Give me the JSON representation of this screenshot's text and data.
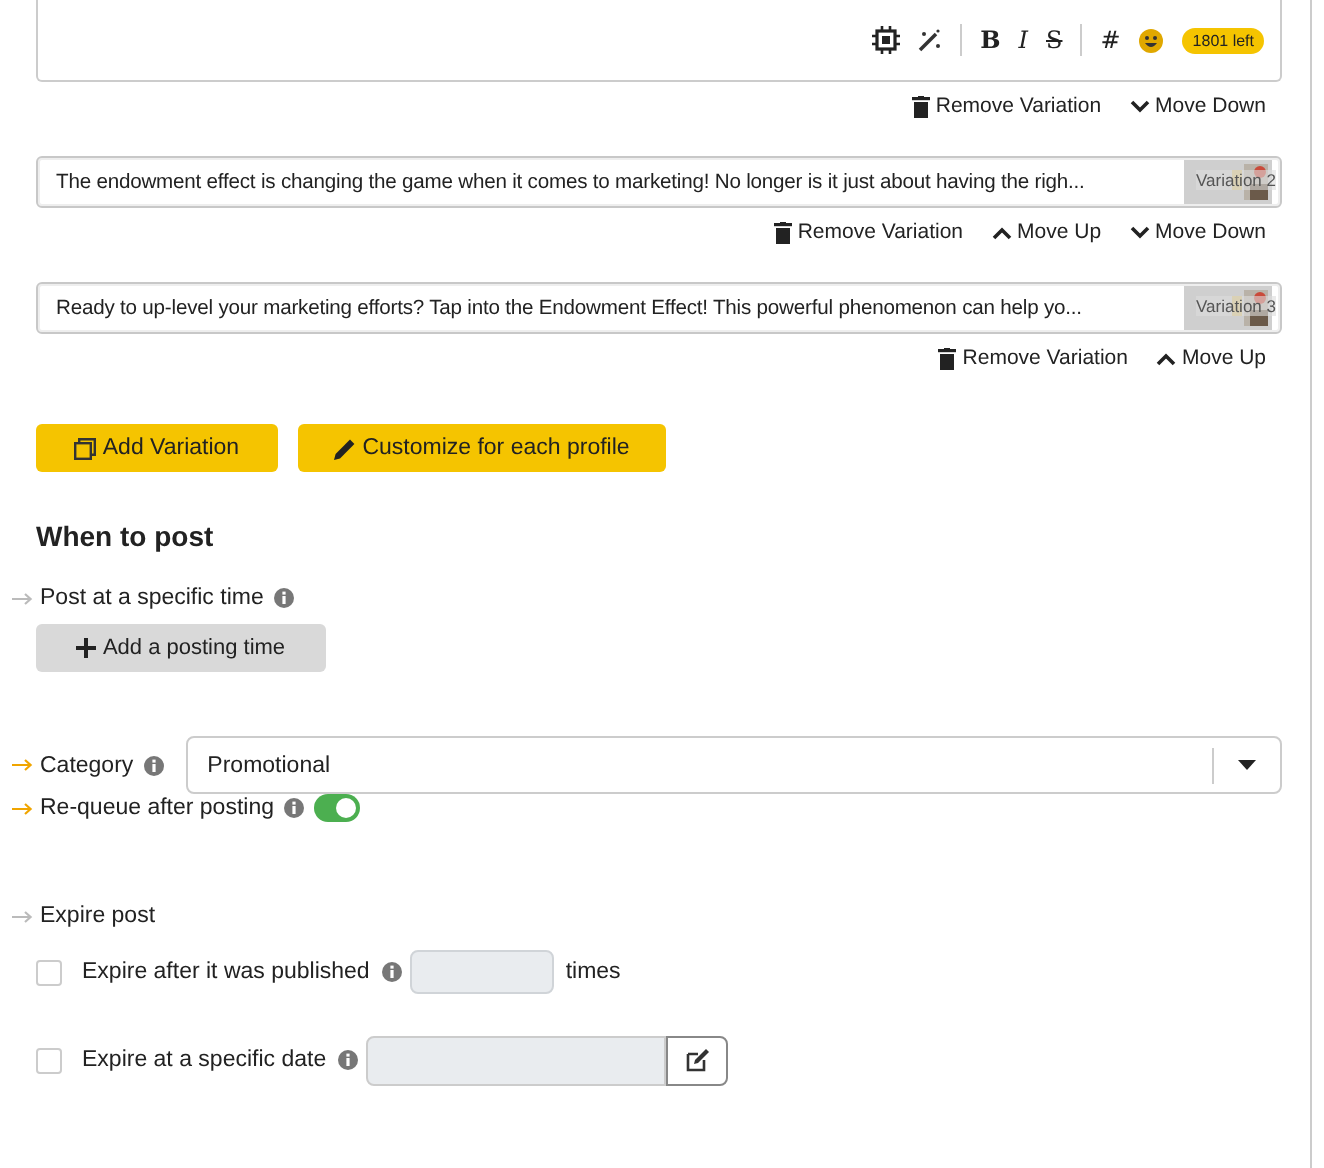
{
  "editor": {
    "toolbar": {
      "bold": "B",
      "italic": "I",
      "strike": "S",
      "hashtag": "#",
      "counter": "1801 left"
    },
    "actions": [
      {
        "kind": "remove",
        "label": "Remove Variation"
      },
      {
        "kind": "down",
        "label": "Move Down"
      }
    ]
  },
  "variations": [
    {
      "text": "The endowment effect is changing the game when it comes to marketing! No longer is it just about having the righ...",
      "tag": "Variation 2",
      "actions": [
        {
          "kind": "remove",
          "label": "Remove Variation"
        },
        {
          "kind": "up",
          "label": "Move Up"
        },
        {
          "kind": "down",
          "label": "Move Down"
        }
      ]
    },
    {
      "text": "Ready to up-level your marketing efforts? Tap into the Endowment Effect! This powerful phenomenon can help yo...",
      "tag": "Variation 3",
      "actions": [
        {
          "kind": "remove",
          "label": "Remove Variation"
        },
        {
          "kind": "up",
          "label": "Move Up"
        }
      ]
    }
  ],
  "buttons": [
    {
      "kind": "copy",
      "label": "Add Variation"
    },
    {
      "kind": "pencil",
      "label": "Customize for each profile"
    }
  ],
  "when_to_post": {
    "heading": "When to post",
    "specific_time": {
      "label": "Post at a specific time",
      "highlighted": false,
      "button": "Add a posting time"
    },
    "category": {
      "label": "Category",
      "highlighted": true,
      "value": "Promotional"
    },
    "requeue": {
      "label": "Re-queue after posting",
      "highlighted": true,
      "on": true
    },
    "expire": {
      "label": "Expire post",
      "highlighted": false,
      "after_published": {
        "label": "Expire after it was published",
        "checked": false,
        "unit": "times"
      },
      "specific_date": {
        "label": "Expire at a specific date",
        "checked": false
      }
    }
  }
}
